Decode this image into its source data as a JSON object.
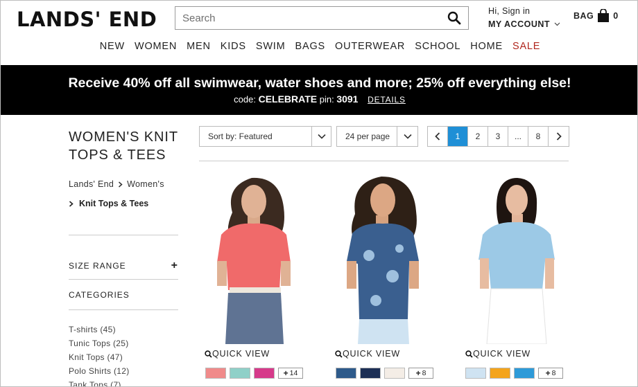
{
  "header": {
    "logo": "LANDS' END",
    "search_placeholder": "Search",
    "greeting": "Hi, Sign in",
    "account_label": "MY ACCOUNT",
    "bag_label": "BAG",
    "bag_count": "0"
  },
  "nav": {
    "items": [
      "NEW",
      "WOMEN",
      "MEN",
      "KIDS",
      "SWIM",
      "BAGS",
      "OUTERWEAR",
      "SCHOOL",
      "HOME",
      "SALE"
    ],
    "sale_color": "#b0261e"
  },
  "promo": {
    "headline": "Receive 40% off all swimwear, water shoes and more; 25% off everything else!",
    "code_prefix": "code:",
    "code": "CELEBRATE",
    "pin_prefix": "pin:",
    "pin": "3091",
    "details_label": "DETAILS"
  },
  "sidebar": {
    "title_line1": "WOMEN'S KNIT",
    "title_line2": "TOPS & TEES",
    "breadcrumbs": [
      "Lands' End",
      "Women's"
    ],
    "current": "Knit Tops & Tees",
    "facets": [
      "SIZE RANGE",
      "CATEGORIES"
    ],
    "categories": [
      "T-shirts (45)",
      "Tunic Tops (25)",
      "Knit Tops (47)",
      "Polo Shirts (12)",
      "Tank Tops (7)"
    ]
  },
  "toolbar": {
    "sort_label": "Sort by: Featured",
    "per_page_label": "24 per page",
    "pages": [
      "1",
      "2",
      "3",
      "...",
      "8"
    ],
    "active_page": "1",
    "accent_color": "#1f8fd6"
  },
  "products": [
    {
      "quick_view": "QUICK VIEW",
      "shirt_color": "#f06a6a",
      "swatches": [
        "#f08a8a",
        "#8fd0c8",
        "#d63a8a"
      ],
      "more_label": "14"
    },
    {
      "quick_view": "QUICK VIEW",
      "shirt_color": "#3a5f8f",
      "swatches": [
        "#2e5a8a",
        "#1c2f55",
        "#f4ede6"
      ],
      "more_label": "8"
    },
    {
      "quick_view": "QUICK VIEW",
      "shirt_color": "#9cc9e6",
      "swatches": [
        "#cfe3f2",
        "#f4a41c",
        "#2e9ad8"
      ],
      "more_label": "8"
    }
  ]
}
